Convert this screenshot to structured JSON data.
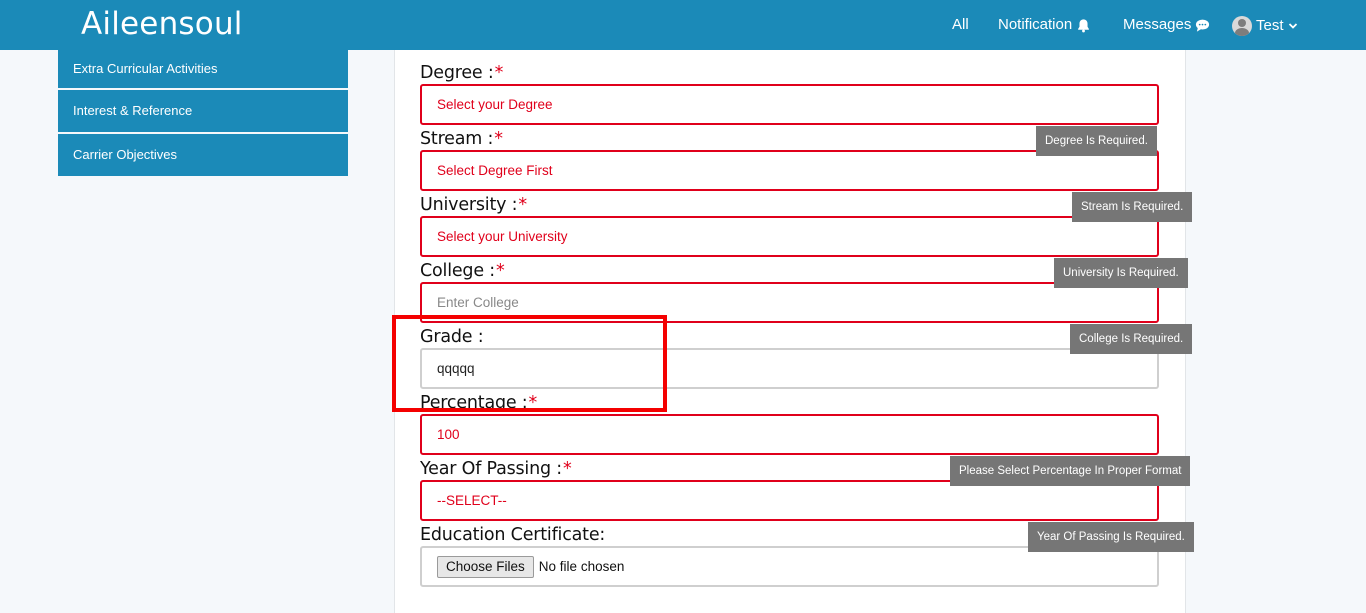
{
  "nav": {
    "brand": "Aileensoul",
    "all": "All",
    "notification": "Notification",
    "messages": "Messages",
    "user": "Test",
    "icons": {
      "notification": "bell-icon",
      "messages": "chat-bubble-icon",
      "user": "avatar",
      "dropdown": "chevron-down-icon"
    }
  },
  "sidebar": {
    "items": [
      {
        "label": "Extra Curricular Activities"
      },
      {
        "label": "Interest & Reference"
      },
      {
        "label": "Carrier Objectives"
      }
    ]
  },
  "form": {
    "required_mark": "*",
    "degree": {
      "label": "Degree :",
      "value": "Select your Degree",
      "error": "Degree Is Required."
    },
    "stream": {
      "label": "Stream :",
      "value": "Select Degree First",
      "error": "Stream Is Required."
    },
    "university": {
      "label": "University :",
      "value": "Select your University",
      "error": "University Is Required."
    },
    "college": {
      "label": "College :",
      "placeholder": "Enter College",
      "error": "College Is Required."
    },
    "grade": {
      "label": "Grade :",
      "value": "qqqqq"
    },
    "percentage": {
      "label": "Percentage :",
      "value": "100",
      "error": "Please Select Percentage In Proper Format"
    },
    "year": {
      "label": "Year Of Passing :",
      "value": "--SELECT--",
      "error": "Year Of Passing Is Required."
    },
    "certificate": {
      "label": "Education Certificate:",
      "button": "Choose Files",
      "status": "No file chosen"
    }
  },
  "colors": {
    "brand": "#1b8ab8",
    "error": "#e0001b",
    "tooltip": "#767676",
    "highlight": "#f40000"
  }
}
